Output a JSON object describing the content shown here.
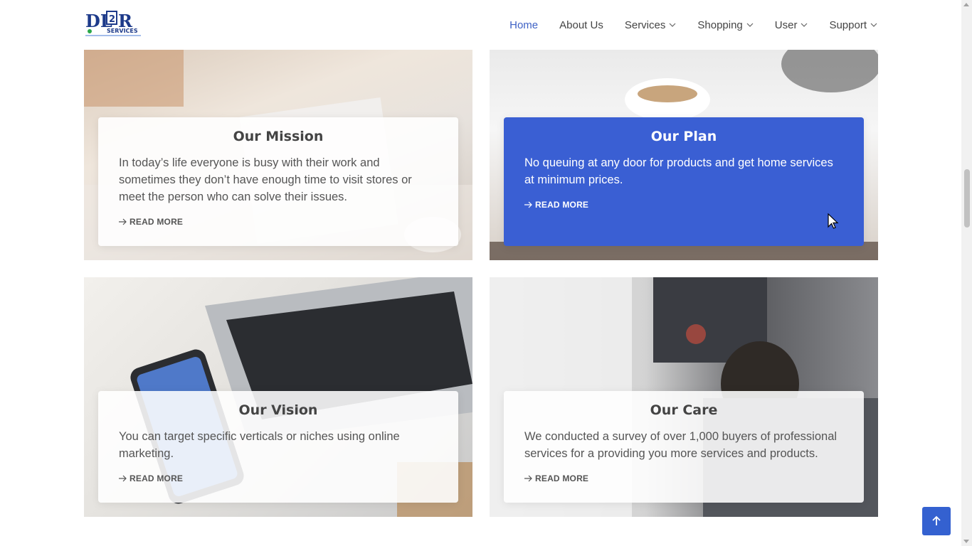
{
  "header": {
    "logo_text": "DL2R SERVICES",
    "nav": [
      {
        "label": "Home",
        "active": true,
        "dropdown": false
      },
      {
        "label": "About Us",
        "active": false,
        "dropdown": false
      },
      {
        "label": "Services",
        "active": false,
        "dropdown": true
      },
      {
        "label": "Shopping",
        "active": false,
        "dropdown": true
      },
      {
        "label": "User",
        "active": false,
        "dropdown": true
      },
      {
        "label": "Support",
        "active": false,
        "dropdown": true
      }
    ]
  },
  "cards": [
    {
      "title": "Our Mission",
      "text": "In today’s life everyone is busy with their work and sometimes they don’t have enough time to visit stores or meet the person who can solve their issues.",
      "link": "READ MORE",
      "active": false
    },
    {
      "title": "Our Plan",
      "text": "No queuing at any door for products and get home services at minimum prices.",
      "link": "READ MORE",
      "active": true
    },
    {
      "title": "Our Vision",
      "text": "You can target specific verticals or niches using online marketing.",
      "link": "READ MORE",
      "active": false
    },
    {
      "title": "Our Care",
      "text": "We conducted a survey of over 1,000 buyers of professional services for a providing you more services and products.",
      "link": "READ MORE",
      "active": false
    }
  ],
  "colors": {
    "accent": "#3f62c5",
    "active_panel": "#3a5fd3",
    "back_to_top": "#3461d0"
  },
  "icons": {
    "back_to_top": "arrow-up-icon",
    "read_more": "arrow-right-icon",
    "dropdown": "chevron-down-icon"
  }
}
